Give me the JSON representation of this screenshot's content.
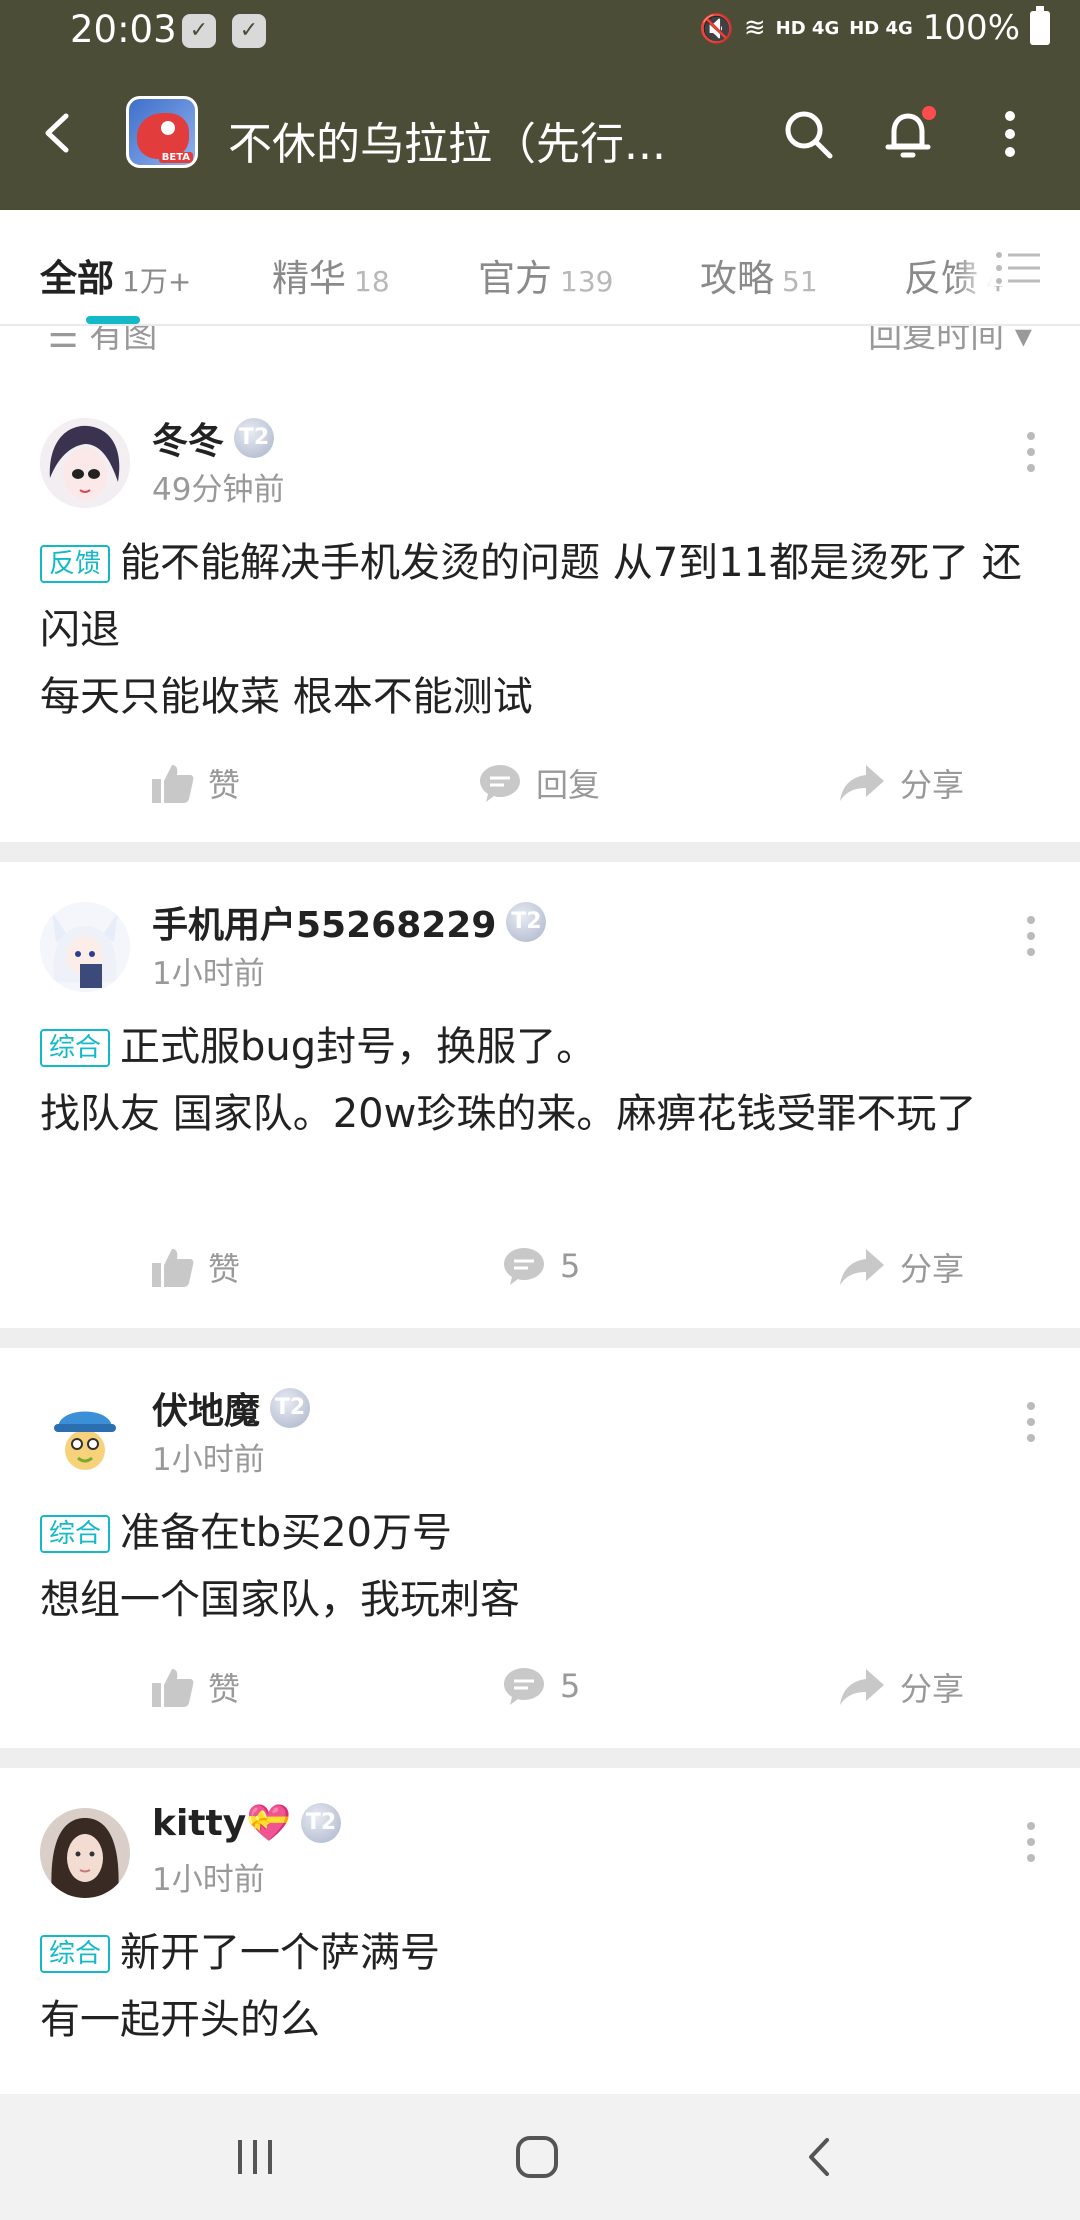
{
  "status": {
    "time": "20:03",
    "net1": "HD 4G",
    "net2": "HD 4G",
    "battery": "100%"
  },
  "app": {
    "title": "不休的乌拉拉（先行...",
    "icon_tag": "BETA"
  },
  "tabs": [
    {
      "label": "全部",
      "count": "1万+"
    },
    {
      "label": "精华",
      "count": "18"
    },
    {
      "label": "官方",
      "count": "139"
    },
    {
      "label": "攻略",
      "count": "51"
    },
    {
      "label": "反馈",
      "count": "4"
    }
  ],
  "filter": {
    "left": "有图",
    "right": "回复时间"
  },
  "actions": {
    "like": "赞",
    "reply": "回复",
    "share": "分享"
  },
  "posts": [
    {
      "user": "冬冬",
      "level": "T2",
      "time": "49分钟前",
      "category": "反馈",
      "line1": "能不能解决手机发烫的问题 从7到11都是烫死了 还闪退",
      "line2": "每天只能收菜 根本不能测试",
      "reply_label": "回复"
    },
    {
      "user": "手机用户55268229",
      "level": "T2",
      "time": "1小时前",
      "category": "综合",
      "line1": "正式服bug封号，换服了。",
      "line2": "找队友 国家队。20w珍珠的来。麻痹花钱受罪不玩了",
      "reply_label": "5"
    },
    {
      "user": "伏地魔",
      "level": "T2",
      "time": "1小时前",
      "category": "综合",
      "line1": "准备在tb买20万号",
      "line2": "想组一个国家队，我玩刺客",
      "reply_label": "5"
    },
    {
      "user": "kitty💝",
      "level": "T2",
      "time": "1小时前",
      "category": "综合",
      "line1": "新开了一个萨满号",
      "line2": "有一起开头的么"
    }
  ],
  "colors": {
    "header": "#4c4d37",
    "accent": "#14b9c8",
    "divider": "#eeeeee"
  }
}
